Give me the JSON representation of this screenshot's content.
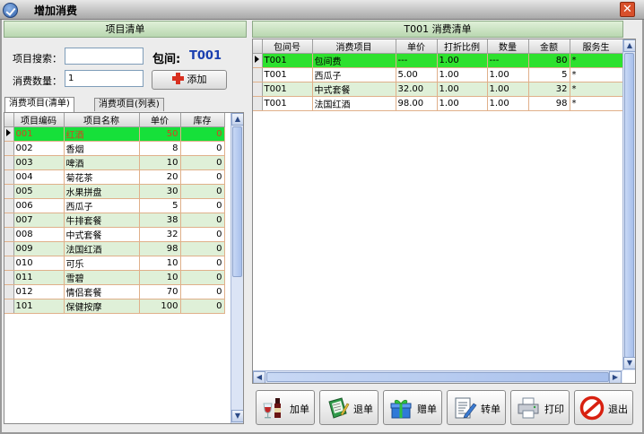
{
  "window": {
    "title": "增加消费",
    "close": "✕"
  },
  "left": {
    "title": "项目清单",
    "search_label": "项目搜索：",
    "search_value": "",
    "qty_label": "消费数量：",
    "qty_value": "1",
    "room_label": "包间:",
    "room_code": "T001",
    "add_label": "添加",
    "tabs": [
      "消费项目(清单)",
      "消费项目(列表)"
    ],
    "columns": [
      "项目编码",
      "项目名称",
      "单价",
      "库存"
    ],
    "rows": [
      [
        "001",
        "红酒",
        "50",
        "0"
      ],
      [
        "002",
        "香烟",
        "8",
        "0"
      ],
      [
        "003",
        "啤酒",
        "10",
        "0"
      ],
      [
        "004",
        "菊花茶",
        "20",
        "0"
      ],
      [
        "005",
        "水果拼盘",
        "30",
        "0"
      ],
      [
        "006",
        "西瓜子",
        "5",
        "0"
      ],
      [
        "007",
        "牛排套餐",
        "38",
        "0"
      ],
      [
        "008",
        "中式套餐",
        "32",
        "0"
      ],
      [
        "009",
        "法国红酒",
        "98",
        "0"
      ],
      [
        "010",
        "可乐",
        "10",
        "0"
      ],
      [
        "011",
        "雪碧",
        "10",
        "0"
      ],
      [
        "012",
        "情侣套餐",
        "70",
        "0"
      ],
      [
        "101",
        "保健按摩",
        "100",
        "0"
      ]
    ]
  },
  "right": {
    "title": "T001   消费清单",
    "columns": [
      "包间号",
      "消费项目",
      "单价",
      "打折比例",
      "数量",
      "金额",
      "服务生"
    ],
    "rows": [
      [
        "T001",
        "包间费",
        "---",
        "1.00",
        "---",
        "80",
        "*"
      ],
      [
        "T001",
        "西瓜子",
        "5.00",
        "1.00",
        "1.00",
        "5",
        "*"
      ],
      [
        "T001",
        "中式套餐",
        "32.00",
        "1.00",
        "1.00",
        "32",
        "*"
      ],
      [
        "T001",
        "法国红酒",
        "98.00",
        "1.00",
        "1.00",
        "98",
        "*"
      ]
    ]
  },
  "toolbar": {
    "add": "加单",
    "refund": "退单",
    "gift": "赠单",
    "transfer": "转单",
    "print": "打印",
    "exit": "退出"
  },
  "colors": {
    "title_green": "#dff0d8",
    "selected_row": "#16e03a",
    "room_code": "#1a3fb0"
  }
}
